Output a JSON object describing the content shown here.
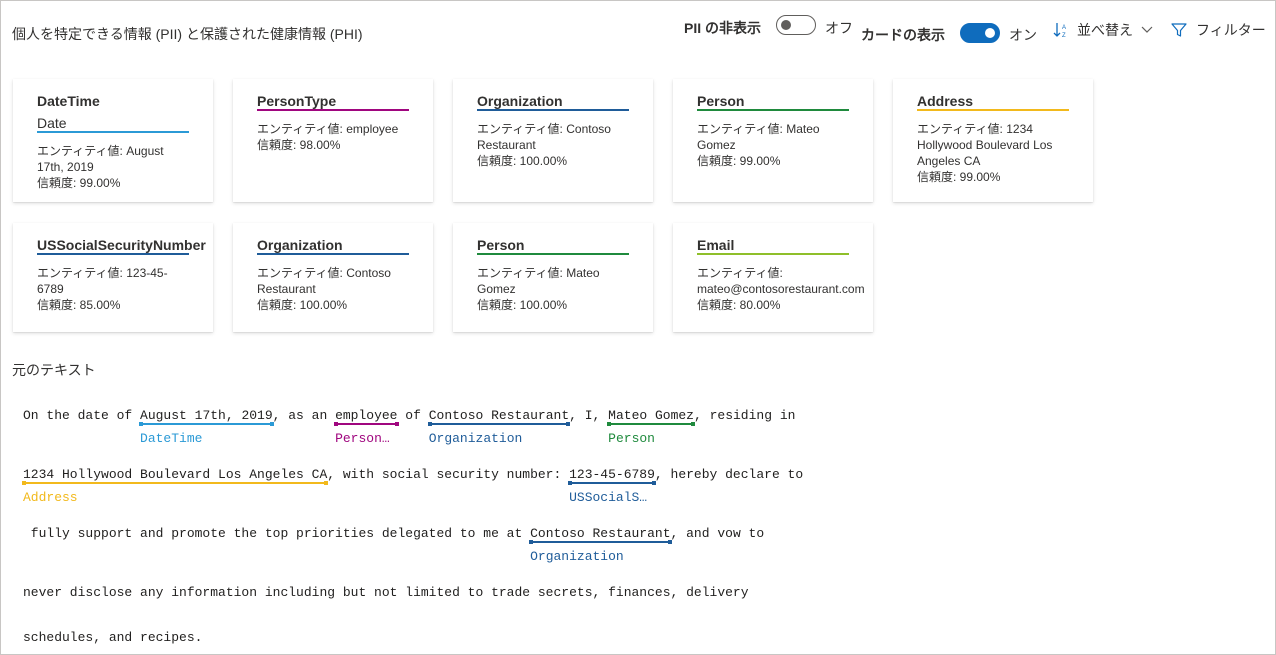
{
  "header": {
    "title": "個人を特定できる情報 (PII) と保護された健康情報 (PHI)",
    "pii_hide_label": "PII の非表示",
    "pii_hide_state": "オフ",
    "card_show_label": "カードの表示",
    "card_show_state": "オン",
    "sort_label": "並べ替え",
    "filter_label": "フィルター"
  },
  "colors": {
    "DateTime": "#2b9ad6",
    "PersonType": "#a0067f",
    "Organization": "#1f5c99",
    "Person": "#1f8a3d",
    "Address": "#f2b91c",
    "USSocialSecurityNumber": "#1f5c99",
    "Email": "#8fbf2a",
    "toggle_on": "#0f6cbd"
  },
  "cards": [
    {
      "category": "DateTime",
      "subcategory": "Date",
      "value_line1": "エンティティ値: August",
      "value_line2": "17th, 2019",
      "confidence": "信頼度: 99.00%"
    },
    {
      "category": "PersonType",
      "value_line1": "エンティティ値: employee",
      "confidence": "信頼度: 98.00%"
    },
    {
      "category": "Organization",
      "value_line1": "エンティティ値: Contoso",
      "value_line2": "Restaurant",
      "confidence": "信頼度: 100.00%"
    },
    {
      "category": "Person",
      "value_line1": "エンティティ値: Mateo",
      "value_line2": "Gomez",
      "confidence": "信頼度: 99.00%"
    },
    {
      "category": "Address",
      "value_line1": "エンティティ値: 1234",
      "value_line2": "Hollywood Boulevard Los",
      "value_line3": "Angeles CA",
      "confidence": "信頼度: 99.00%"
    },
    {
      "category": "USSocialSecurityNumber",
      "value_line1": "エンティティ値: 123-45-",
      "value_line2": "6789",
      "confidence": "信頼度: 85.00%"
    },
    {
      "category": "Organization",
      "value_line1": "エンティティ値: Contoso",
      "value_line2": "Restaurant",
      "confidence": "信頼度: 100.00%"
    },
    {
      "category": "Person",
      "value_line1": "エンティティ値: Mateo",
      "value_line2": "Gomez",
      "confidence": "信頼度: 100.00%"
    },
    {
      "category": "Email",
      "value_line1": "エンティティ値:",
      "value_line2": "mateo@contosorestaurant.com",
      "confidence": "信頼度: 80.00%"
    }
  ],
  "original_text": {
    "title": "元のテキスト",
    "line1": {
      "t0": "On the date of ",
      "e0": "August 17th, 2019",
      "l0": "DateTime",
      "t1": ", as an ",
      "e1": "employee",
      "l1": "Person…",
      "t2": " of ",
      "e2": "Contoso Restaurant",
      "l2": "Organization",
      "t3": ", I, ",
      "e3": "Mateo Gomez",
      "l3": "Person",
      "t4": ", residing in"
    },
    "line2": {
      "e0": "1234 Hollywood Boulevard Los Angeles CA",
      "l0": "Address",
      "t0": ", with social security number: ",
      "e1": "123-45-6789",
      "l1": "USSocialS…",
      "t1": ", hereby declare to"
    },
    "line3": {
      "t0": " fully support and promote the top priorities delegated to me at ",
      "e0": "Contoso Restaurant",
      "l0": "Organization",
      "t1": ", and vow to"
    },
    "line4": "never disclose any information including but not limited to trade secrets, finances, delivery",
    "line5": "schedules, and recipes."
  }
}
